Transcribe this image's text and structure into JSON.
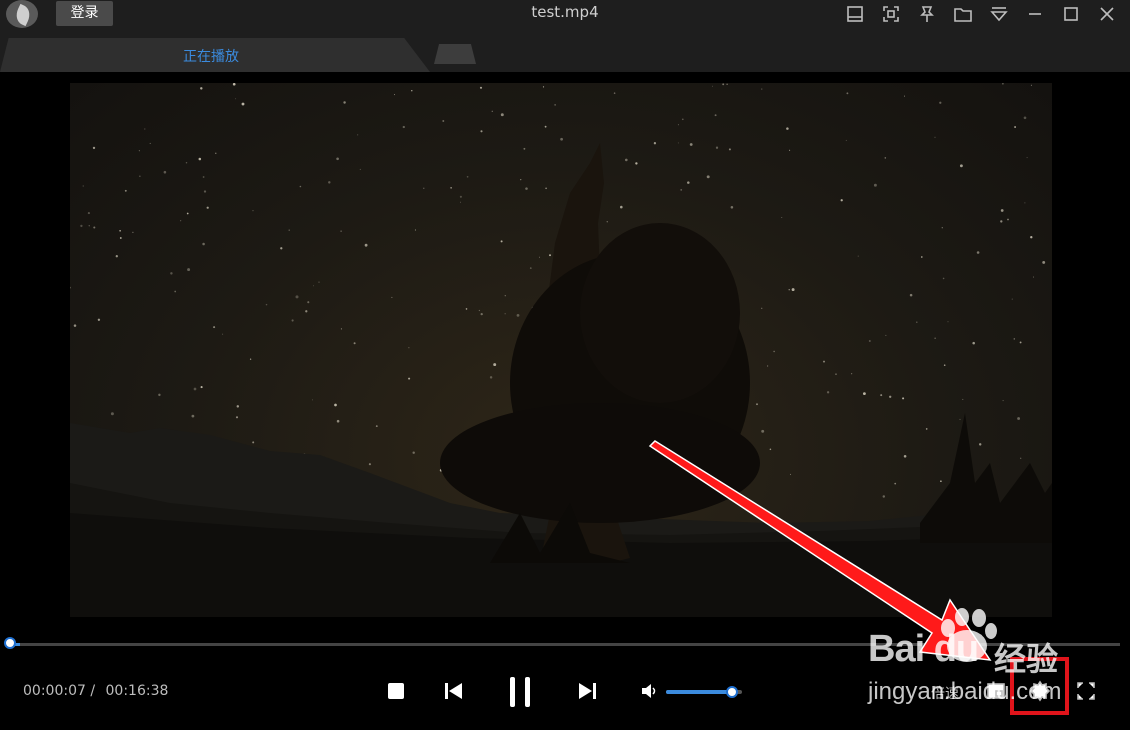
{
  "window": {
    "login_label": "登录",
    "title": "test.mp4"
  },
  "tabs": {
    "active_label": "正在播放"
  },
  "playback": {
    "current_time": "00:00:07 /",
    "duration": "00:16:38",
    "progress_fraction": 0.007,
    "volume_fraction": 0.88,
    "state": "playing"
  },
  "right_controls": {
    "speed_label": "倍速"
  },
  "watermark": {
    "brand": "Bai du",
    "brand_cn": "经验",
    "url": "jingyan.baidu.com"
  },
  "colors": {
    "accent": "#3b8bde",
    "highlight_box": "#e0141b",
    "arrow": "#ff1a1a"
  },
  "icons": [
    "logo-icon",
    "mini-mode-icon",
    "screenshot-icon",
    "pin-icon",
    "folder-icon",
    "menu-icon",
    "minimize-icon",
    "maximize-icon",
    "close-icon",
    "stop-icon",
    "previous-icon",
    "pause-icon",
    "next-icon",
    "volume-icon",
    "picture-icon",
    "settings-icon",
    "fullscreen-icon"
  ]
}
